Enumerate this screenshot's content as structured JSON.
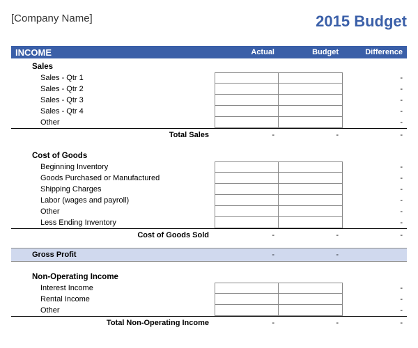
{
  "header": {
    "company": "[Company Name]",
    "title": "2015 Budget"
  },
  "columns": {
    "section": "INCOME",
    "actual": "Actual",
    "budget": "Budget",
    "difference": "Difference"
  },
  "sales": {
    "title": "Sales",
    "rows": [
      "Sales - Qtr 1",
      "Sales - Qtr 2",
      "Sales - Qtr 3",
      "Sales - Qtr 4",
      "Other"
    ],
    "total_label": "Total Sales",
    "total_actual": "-",
    "total_budget": "-",
    "total_diff": "-"
  },
  "cogs": {
    "title": "Cost of Goods",
    "rows": [
      "Beginning Inventory",
      "Goods Purchased or Manufactured",
      "Shipping Charges",
      "Labor (wages and payroll)",
      "Other",
      "Less Ending Inventory"
    ],
    "total_label": "Cost of Goods Sold",
    "total_actual": "-",
    "total_budget": "-",
    "total_diff": "-"
  },
  "gross": {
    "label": "Gross Profit",
    "actual": "-",
    "budget": "-",
    "diff": ""
  },
  "nonop": {
    "title": "Non-Operating Income",
    "rows": [
      "Interest Income",
      "Rental Income",
      "Other"
    ],
    "total_label": "Total Non-Operating Income",
    "total_actual": "-",
    "total_budget": "-",
    "total_diff": "-"
  },
  "dash": "-"
}
